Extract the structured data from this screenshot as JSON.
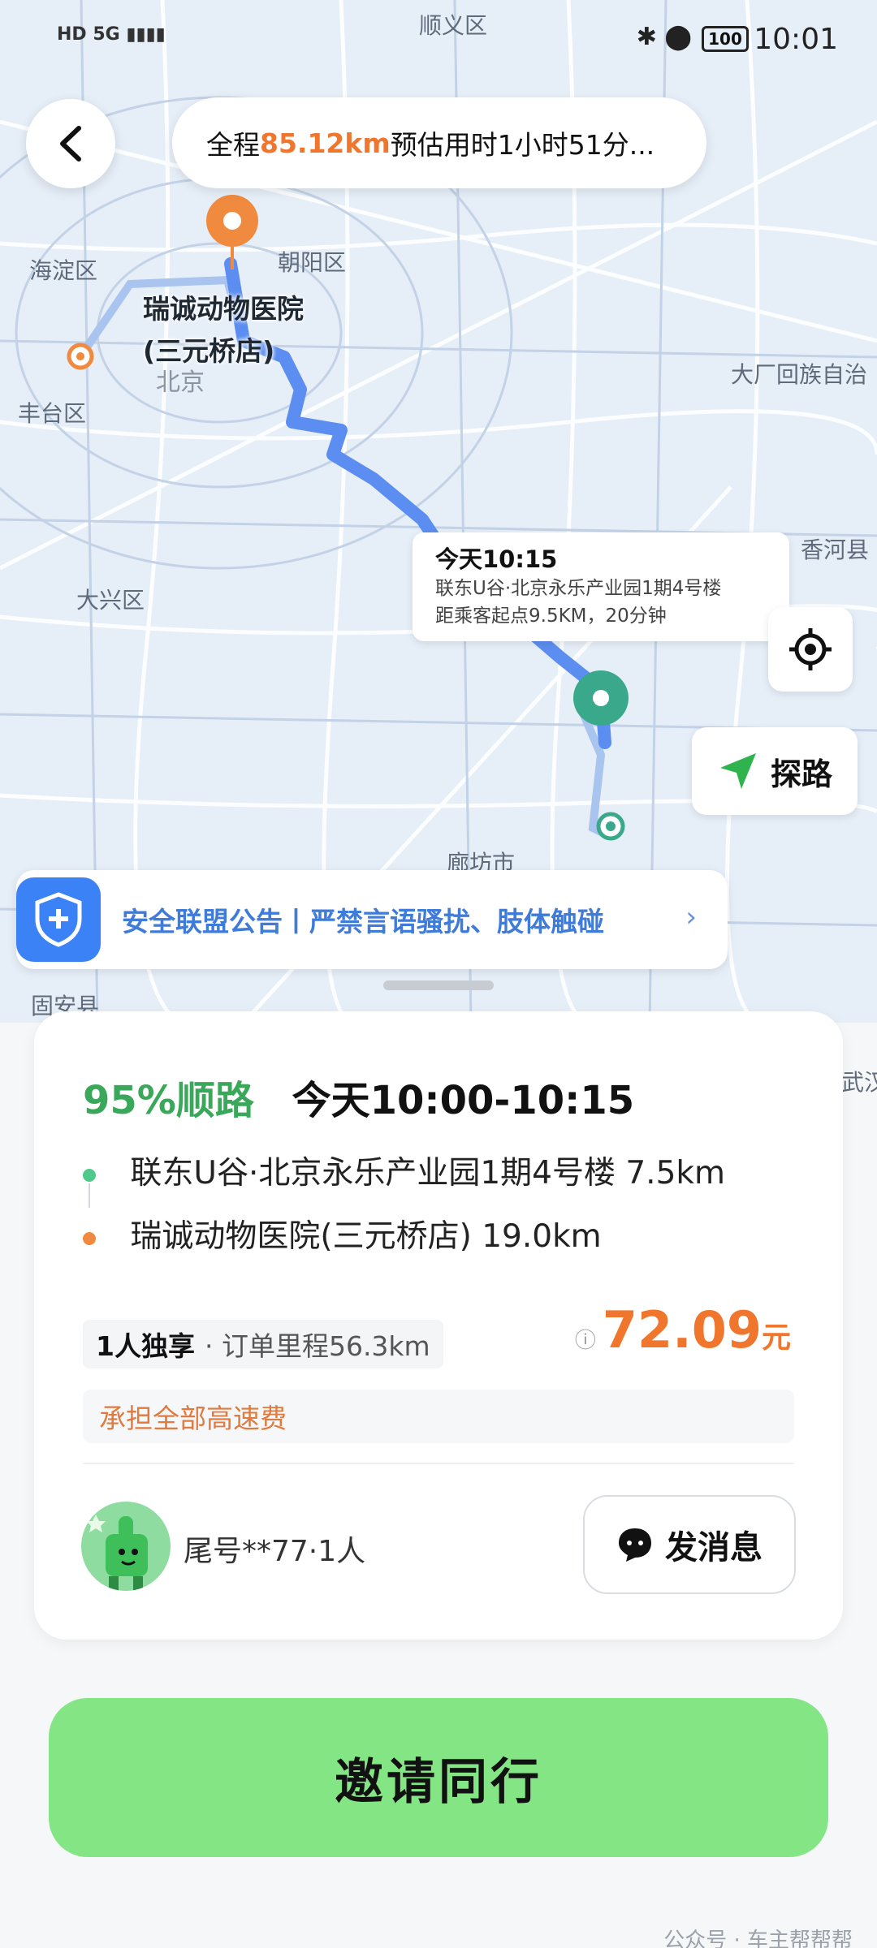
{
  "status_bar": {
    "left": "HD 5G ▮▮▮▮",
    "battery": "100",
    "time": "10:01"
  },
  "map": {
    "labels": [
      "顺义区",
      "海淀区",
      "朝阳区",
      "丰台区",
      "北京",
      "大厂回族自治",
      "香河县",
      "大兴区",
      "廊坊市",
      "固安县",
      "武汉"
    ],
    "destination_label_line1": "瑞诚动物医院",
    "destination_label_line2": "(三元桥店)",
    "route_color": "#5b8ef0",
    "origin_marker_color": "#3aa98b",
    "dest_marker_color": "#f08a3e"
  },
  "route_summary": {
    "prefix": "全程",
    "distance": "85.12km",
    "rest": " 预估用时1小时51分..."
  },
  "pickup_info": {
    "title": "今天10:15",
    "line1": "联东U谷·北京永乐产业园1期4号楼",
    "line2": "距乘客起点9.5KM，20分钟"
  },
  "explore_button": "探路",
  "notice": {
    "text": "安全联盟公告丨严禁言语骚扰、肢体触碰",
    "chevron": "›"
  },
  "order": {
    "match": "95%顺路",
    "time": "今天10:00-10:15",
    "origin": "联东U谷·北京永乐产业园1期4号楼 7.5km",
    "destination": "瑞诚动物医院(三元桥店) 19.0km",
    "origin_color": "#4fc98a",
    "destination_color": "#f08a3e",
    "ride_type": "1人独享",
    "mileage": "· 订单里程56.3km",
    "price_info_icon": "ⓘ",
    "price": "72.09",
    "price_unit": "元",
    "toll_note": "承担全部高速费",
    "passenger": "尾号**77·1人",
    "message_button": "发消息"
  },
  "invite_button": "邀请同行",
  "watermark": "公众号 · 车主帮帮帮"
}
